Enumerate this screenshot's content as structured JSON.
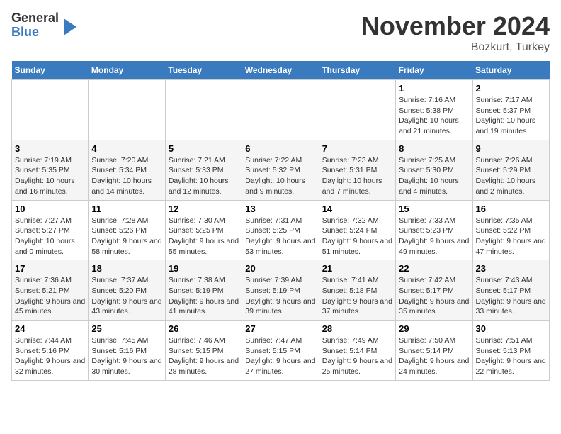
{
  "header": {
    "logo_general": "General",
    "logo_blue": "Blue",
    "month_title": "November 2024",
    "location": "Bozkurt, Turkey"
  },
  "days_of_week": [
    "Sunday",
    "Monday",
    "Tuesday",
    "Wednesday",
    "Thursday",
    "Friday",
    "Saturday"
  ],
  "weeks": [
    [
      {
        "day": "",
        "info": ""
      },
      {
        "day": "",
        "info": ""
      },
      {
        "day": "",
        "info": ""
      },
      {
        "day": "",
        "info": ""
      },
      {
        "day": "",
        "info": ""
      },
      {
        "day": "1",
        "info": "Sunrise: 7:16 AM\nSunset: 5:38 PM\nDaylight: 10 hours and 21 minutes."
      },
      {
        "day": "2",
        "info": "Sunrise: 7:17 AM\nSunset: 5:37 PM\nDaylight: 10 hours and 19 minutes."
      }
    ],
    [
      {
        "day": "3",
        "info": "Sunrise: 7:19 AM\nSunset: 5:35 PM\nDaylight: 10 hours and 16 minutes."
      },
      {
        "day": "4",
        "info": "Sunrise: 7:20 AM\nSunset: 5:34 PM\nDaylight: 10 hours and 14 minutes."
      },
      {
        "day": "5",
        "info": "Sunrise: 7:21 AM\nSunset: 5:33 PM\nDaylight: 10 hours and 12 minutes."
      },
      {
        "day": "6",
        "info": "Sunrise: 7:22 AM\nSunset: 5:32 PM\nDaylight: 10 hours and 9 minutes."
      },
      {
        "day": "7",
        "info": "Sunrise: 7:23 AM\nSunset: 5:31 PM\nDaylight: 10 hours and 7 minutes."
      },
      {
        "day": "8",
        "info": "Sunrise: 7:25 AM\nSunset: 5:30 PM\nDaylight: 10 hours and 4 minutes."
      },
      {
        "day": "9",
        "info": "Sunrise: 7:26 AM\nSunset: 5:29 PM\nDaylight: 10 hours and 2 minutes."
      }
    ],
    [
      {
        "day": "10",
        "info": "Sunrise: 7:27 AM\nSunset: 5:27 PM\nDaylight: 10 hours and 0 minutes."
      },
      {
        "day": "11",
        "info": "Sunrise: 7:28 AM\nSunset: 5:26 PM\nDaylight: 9 hours and 58 minutes."
      },
      {
        "day": "12",
        "info": "Sunrise: 7:30 AM\nSunset: 5:25 PM\nDaylight: 9 hours and 55 minutes."
      },
      {
        "day": "13",
        "info": "Sunrise: 7:31 AM\nSunset: 5:25 PM\nDaylight: 9 hours and 53 minutes."
      },
      {
        "day": "14",
        "info": "Sunrise: 7:32 AM\nSunset: 5:24 PM\nDaylight: 9 hours and 51 minutes."
      },
      {
        "day": "15",
        "info": "Sunrise: 7:33 AM\nSunset: 5:23 PM\nDaylight: 9 hours and 49 minutes."
      },
      {
        "day": "16",
        "info": "Sunrise: 7:35 AM\nSunset: 5:22 PM\nDaylight: 9 hours and 47 minutes."
      }
    ],
    [
      {
        "day": "17",
        "info": "Sunrise: 7:36 AM\nSunset: 5:21 PM\nDaylight: 9 hours and 45 minutes."
      },
      {
        "day": "18",
        "info": "Sunrise: 7:37 AM\nSunset: 5:20 PM\nDaylight: 9 hours and 43 minutes."
      },
      {
        "day": "19",
        "info": "Sunrise: 7:38 AM\nSunset: 5:19 PM\nDaylight: 9 hours and 41 minutes."
      },
      {
        "day": "20",
        "info": "Sunrise: 7:39 AM\nSunset: 5:19 PM\nDaylight: 9 hours and 39 minutes."
      },
      {
        "day": "21",
        "info": "Sunrise: 7:41 AM\nSunset: 5:18 PM\nDaylight: 9 hours and 37 minutes."
      },
      {
        "day": "22",
        "info": "Sunrise: 7:42 AM\nSunset: 5:17 PM\nDaylight: 9 hours and 35 minutes."
      },
      {
        "day": "23",
        "info": "Sunrise: 7:43 AM\nSunset: 5:17 PM\nDaylight: 9 hours and 33 minutes."
      }
    ],
    [
      {
        "day": "24",
        "info": "Sunrise: 7:44 AM\nSunset: 5:16 PM\nDaylight: 9 hours and 32 minutes."
      },
      {
        "day": "25",
        "info": "Sunrise: 7:45 AM\nSunset: 5:16 PM\nDaylight: 9 hours and 30 minutes."
      },
      {
        "day": "26",
        "info": "Sunrise: 7:46 AM\nSunset: 5:15 PM\nDaylight: 9 hours and 28 minutes."
      },
      {
        "day": "27",
        "info": "Sunrise: 7:47 AM\nSunset: 5:15 PM\nDaylight: 9 hours and 27 minutes."
      },
      {
        "day": "28",
        "info": "Sunrise: 7:49 AM\nSunset: 5:14 PM\nDaylight: 9 hours and 25 minutes."
      },
      {
        "day": "29",
        "info": "Sunrise: 7:50 AM\nSunset: 5:14 PM\nDaylight: 9 hours and 24 minutes."
      },
      {
        "day": "30",
        "info": "Sunrise: 7:51 AM\nSunset: 5:13 PM\nDaylight: 9 hours and 22 minutes."
      }
    ]
  ]
}
